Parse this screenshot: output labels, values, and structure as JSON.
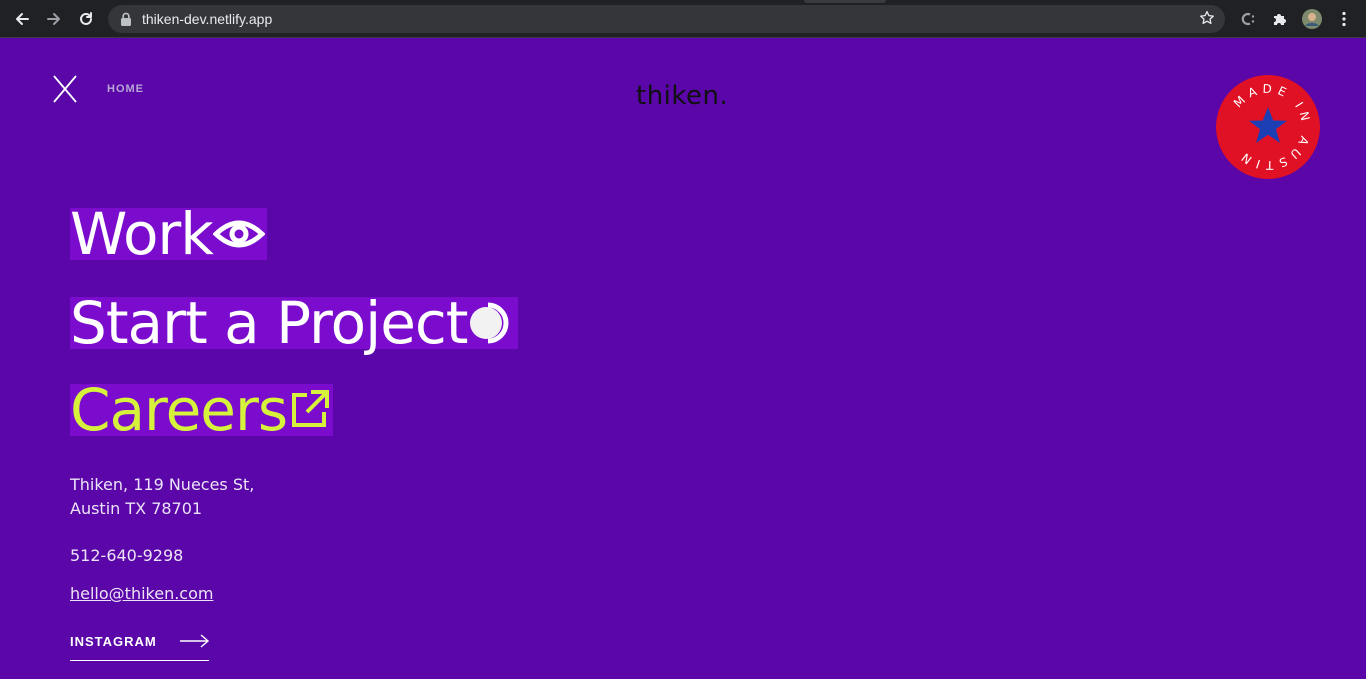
{
  "browser": {
    "url": "thiken-dev.netlify.app",
    "icons": [
      "back-icon",
      "forward-icon",
      "reload-icon",
      "lock-icon",
      "bookmark-star-icon",
      "extension-c-icon",
      "puzzle-icon",
      "profile-avatar",
      "kebab-menu-icon"
    ]
  },
  "nav": {
    "home_label": "HOME",
    "logo": "thiken."
  },
  "badge": {
    "text": "MADE IN AUSTIN",
    "colors": {
      "circle": "#e01025",
      "star": "#1d3fb5",
      "text": "#ffffff"
    }
  },
  "menu": {
    "items": [
      {
        "label": "Work",
        "icon": "eye-icon"
      },
      {
        "label": "Start a Project",
        "icon": "toggle-dot-icon"
      },
      {
        "label": "Careers",
        "icon": "external-link-icon"
      }
    ]
  },
  "contact": {
    "address_line1": "Thiken, 119 Nueces St,",
    "address_line2": "Austin TX 78701",
    "phone": "512-640-9298",
    "email": "hello@thiken.com",
    "instagram_label": "INSTAGRAM"
  },
  "colors": {
    "background": "#5a06a8",
    "highlight": "#7b0ccd",
    "accent": "#d6f23a"
  }
}
